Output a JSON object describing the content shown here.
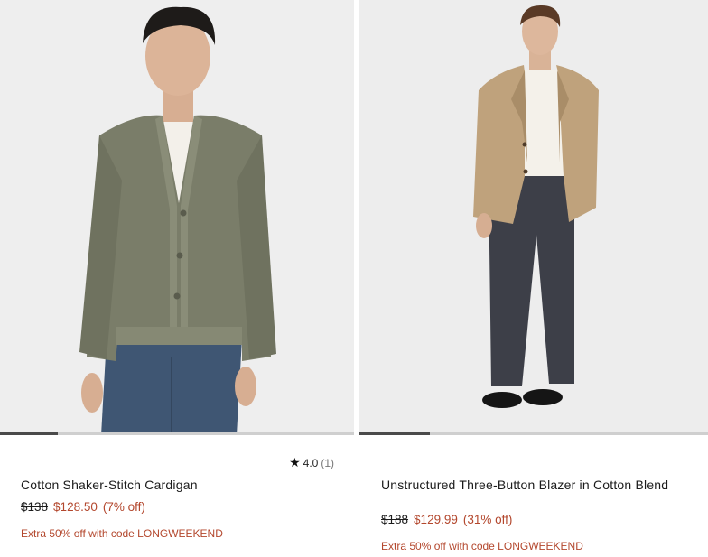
{
  "products": [
    {
      "title": "Cotton Shaker-Stitch Cardigan",
      "original_price": "$138",
      "sale_price": "$128.50",
      "discount": "(7% off)",
      "promo": "Extra 50% off with code LONGWEEKEND",
      "rating": "4.0",
      "review_count": "(1)",
      "image_alt": "Man wearing olive cotton shaker-stitch cardigan"
    },
    {
      "title": "Unstructured Three-Button Blazer in Cotton Blend",
      "original_price": "$188",
      "sale_price": "$129.99",
      "discount": "(31% off)",
      "promo": "Extra 50% off with code LONGWEEKEND",
      "image_alt": "Man wearing khaki unstructured three-button blazer"
    }
  ],
  "colors": {
    "sale": "#b3472d",
    "image_bg": "#efefef",
    "cardigan": "#7a7d69",
    "blazer": "#bfa27c",
    "pants": "#3d3f48",
    "jeans": "#3f5673"
  }
}
